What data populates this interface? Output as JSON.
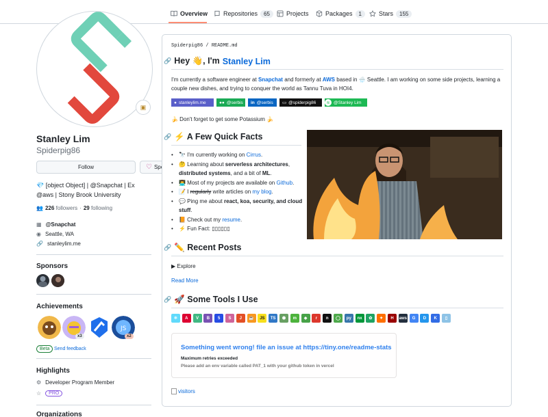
{
  "tabs": [
    {
      "label": "Overview",
      "count": null,
      "icon": "book-icon"
    },
    {
      "label": "Repositories",
      "count": "65",
      "icon": "repo-icon"
    },
    {
      "label": "Projects",
      "count": null,
      "icon": "table-icon"
    },
    {
      "label": "Packages",
      "count": "1",
      "icon": "package-icon"
    },
    {
      "label": "Stars",
      "count": "155",
      "icon": "star-icon"
    }
  ],
  "profile": {
    "name": "Stanley Lim",
    "login": "Spiderpig86",
    "follow_label": "Follow",
    "sponsor_label": "Sponsor",
    "bio_line1": "💎 [object Object] | @Snapchat | Ex",
    "bio_line2": "@aws | Stony Brook University",
    "followers_count": "226",
    "followers_label": "followers",
    "following_count": "29",
    "following_label": "following",
    "company": "@Snapchat",
    "location": "Seattle, WA",
    "website": "stanleylim.me"
  },
  "sidebar": {
    "sponsors_heading": "Sponsors",
    "achievements_heading": "Achievements",
    "achievement_counts": [
      "x3",
      "x2"
    ],
    "beta_label": "Beta",
    "feedback_label": "Send feedback",
    "highlights_heading": "Highlights",
    "highlight_item": "Developer Program Member",
    "pro_label": "PRO",
    "organizations_heading": "Organizations"
  },
  "readme": {
    "path_user": "Spiderpig86",
    "path_sep": "/",
    "path_file": "README.md",
    "heading_hey": "Hey 👋, I'm",
    "heading_name": "Stanley Lim",
    "intro_1": "I'm currently a software engineer at",
    "intro_snapchat": "Snapchat",
    "intro_2": "and formerly at",
    "intro_aws": "AWS",
    "intro_3": "based in 🌧️ Seattle. I am working on some side projects, learning a couple new dishes, and trying to conquer the world as Tannu Tuva in HOI4.",
    "badges": [
      {
        "label": "stanleylim.me",
        "color": "#5a5fc9"
      },
      {
        "label": "@serbis",
        "color": "#1aaa55"
      },
      {
        "label": "@serbis",
        "color": "#0a66c2"
      },
      {
        "label": "@spiderpig86",
        "color": "#111111"
      },
      {
        "label": "@Stanley Lim",
        "color": "#1db954"
      }
    ],
    "potassium": "🍌 Don't forget to get some Potassium 🍌",
    "facts_heading": "⚡ A Few Quick Facts",
    "facts": {
      "f1_pre": "🔭 I'm currently working on",
      "f1_link": "Cirrus",
      "f1_post": ".",
      "f2_pre": "🤔 Learning about",
      "f2_b1": "serverless architectures",
      "f2_sep": ",",
      "f2_b2": "distributed systems",
      "f2_mid": ", and a bit of",
      "f2_b3": "ML",
      "f2_post": ".",
      "f3_pre": "👨‍💻 Most of my projects are available on",
      "f3_link": "Github",
      "f3_post": ".",
      "f4_pre": "📝 I",
      "f4_strike": "regularly",
      "f4_mid": "write articles on",
      "f4_link": "my blog",
      "f4_post": ".",
      "f5_pre": "💬 Ping me about",
      "f5_b": "react, koa, security, and cloud stuff",
      "f5_post": ".",
      "f6_pre": "📙 Check out my",
      "f6_link": "resume",
      "f6_post": ".",
      "f7": "⚡ Fun Fact: ▯▯▯▯▯▯"
    },
    "posts_heading": "✏️ Recent Posts",
    "explore_label": "Explore",
    "read_more": "Read More",
    "tools_heading": "🚀 Some Tools I Use",
    "tools": [
      {
        "label": "⚛",
        "color": "#61dafb"
      },
      {
        "label": "A",
        "color": "#dd0031"
      },
      {
        "label": "V",
        "color": "#41b883"
      },
      {
        "label": "B",
        "color": "#7952b3"
      },
      {
        "label": "5",
        "color": "#264de4"
      },
      {
        "label": "S",
        "color": "#cf649a"
      },
      {
        "label": "J",
        "color": "#e34f26"
      },
      {
        "label": "☕",
        "color": "#f89820"
      },
      {
        "label": "JS",
        "color": "#f7df1e"
      },
      {
        "label": "TS",
        "color": "#3178c6"
      },
      {
        "label": "⬢",
        "color": "#68a063"
      },
      {
        "label": "m",
        "color": "#4db33d"
      },
      {
        "label": "◆",
        "color": "#47a248"
      },
      {
        "label": "r",
        "color": "#dc382d"
      },
      {
        "label": "n",
        "color": "#111111"
      },
      {
        "label": "◯",
        "color": "#4ea94b"
      },
      {
        "label": "py",
        "color": "#3776ab"
      },
      {
        "label": "nx",
        "color": "#009639"
      },
      {
        "label": "✿",
        "color": "#1fa363"
      },
      {
        "label": "✦",
        "color": "#ff6f00"
      },
      {
        "label": "H",
        "color": "#990000"
      },
      {
        "label": "aws",
        "color": "#232f3e"
      },
      {
        "label": "G",
        "color": "#4285f4"
      },
      {
        "label": "D",
        "color": "#2496ed"
      },
      {
        "label": "K",
        "color": "#326ce5"
      },
      {
        "label": "▯",
        "color": "#8ec3e6"
      }
    ],
    "stats_title": "Something went wrong! file an issue at https://tiny.one/readme-stats",
    "stats_sub": "Maximum retries exceeded",
    "stats_hint": "Please add an env variable called PAT_1 with your github token in vercel",
    "visitors_alt": "visitors"
  }
}
